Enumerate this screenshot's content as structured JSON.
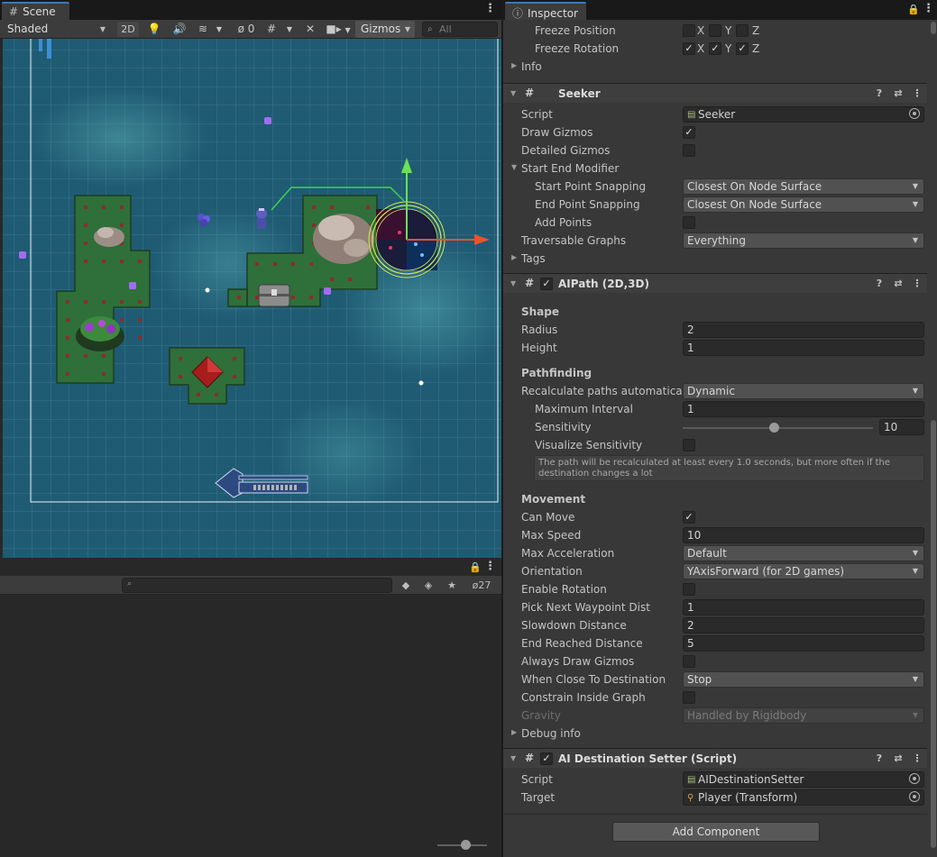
{
  "scene": {
    "tab_label": "Scene",
    "shading_mode": "Shaded",
    "mode_2d_label": "2D",
    "hidden_count": "0",
    "gizmos_label": "Gizmos",
    "search_placeholder": "All"
  },
  "lower_panel": {
    "hidden_count": "27"
  },
  "inspector": {
    "tab_label": "Inspector",
    "rigidbody_constraints": {
      "freeze_position_label": "Freeze Position",
      "freeze_rotation_label": "Freeze Rotation",
      "axes": [
        "X",
        "Y",
        "Z"
      ],
      "freeze_position": [
        false,
        false,
        false
      ],
      "freeze_rotation": [
        true,
        true,
        true
      ],
      "info_label": "Info"
    },
    "seeker": {
      "name": "Seeker",
      "script_label": "Script",
      "script_value": "Seeker",
      "draw_gizmos_label": "Draw Gizmos",
      "draw_gizmos": true,
      "detailed_gizmos_label": "Detailed Gizmos",
      "detailed_gizmos": false,
      "start_end_modifier_label": "Start End Modifier",
      "start_point_snapping_label": "Start Point Snapping",
      "start_point_snapping": "Closest On Node Surface",
      "end_point_snapping_label": "End Point Snapping",
      "end_point_snapping": "Closest On Node Surface",
      "add_points_label": "Add Points",
      "add_points": false,
      "traversable_graphs_label": "Traversable Graphs",
      "traversable_graphs": "Everything",
      "tags_label": "Tags"
    },
    "aipath": {
      "name": "AIPath (2D,3D)",
      "enabled": true,
      "shape_header": "Shape",
      "radius_label": "Radius",
      "radius": "2",
      "height_label": "Height",
      "height": "1",
      "pathfinding_header": "Pathfinding",
      "recalc_label": "Recalculate paths automatically",
      "recalc": "Dynamic",
      "max_interval_label": "Maximum Interval",
      "max_interval": "1",
      "sensitivity_label": "Sensitivity",
      "sensitivity": "10",
      "sensitivity_fraction": 0.48,
      "visualize_sensitivity_label": "Visualize Sensitivity",
      "visualize_sensitivity": false,
      "help_text": "The path will be recalculated at least every 1.0 seconds, but more often if the destination changes a lot",
      "movement_header": "Movement",
      "can_move_label": "Can Move",
      "can_move": true,
      "max_speed_label": "Max Speed",
      "max_speed": "10",
      "max_accel_label": "Max Acceleration",
      "max_accel": "Default",
      "orientation_label": "Orientation",
      "orientation": "YAxisForward (for 2D games)",
      "enable_rotation_label": "Enable Rotation",
      "enable_rotation": false,
      "pick_next_label": "Pick Next Waypoint Dist",
      "pick_next": "1",
      "slowdown_label": "Slowdown Distance",
      "slowdown": "2",
      "end_reached_label": "End Reached Distance",
      "end_reached": "5",
      "always_draw_label": "Always Draw Gizmos",
      "always_draw": false,
      "when_close_label": "When Close To Destination",
      "when_close": "Stop",
      "constrain_label": "Constrain Inside Graph",
      "constrain": false,
      "gravity_label": "Gravity",
      "gravity": "Handled by Rigidbody",
      "debug_info_label": "Debug info"
    },
    "destination_setter": {
      "name": "AI Destination Setter (Script)",
      "enabled": true,
      "script_label": "Script",
      "script_value": "AIDestinationSetter",
      "target_label": "Target",
      "target_value": "Player (Transform)"
    },
    "add_component_label": "Add Component"
  }
}
